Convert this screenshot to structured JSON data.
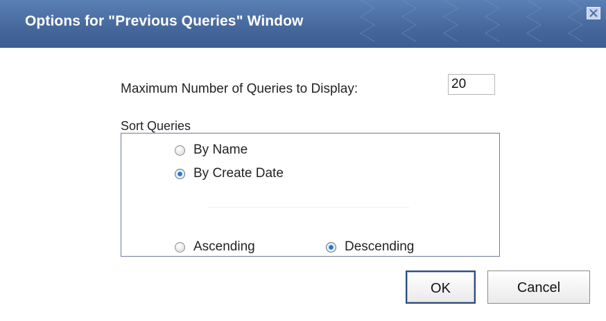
{
  "dialog": {
    "title": "Options for \"Previous Queries\" Window"
  },
  "max_queries": {
    "label": "Maximum Number of Queries to Display:",
    "value": "20"
  },
  "sort": {
    "heading": "Sort Queries",
    "field_options": [
      {
        "label": "By Name",
        "checked": false
      },
      {
        "label": "By Create Date",
        "checked": true
      }
    ],
    "order_options": [
      {
        "label": "Ascending",
        "checked": false
      },
      {
        "label": "Descending",
        "checked": true
      }
    ]
  },
  "buttons": {
    "ok_label": "OK",
    "cancel_label": "Cancel"
  }
}
